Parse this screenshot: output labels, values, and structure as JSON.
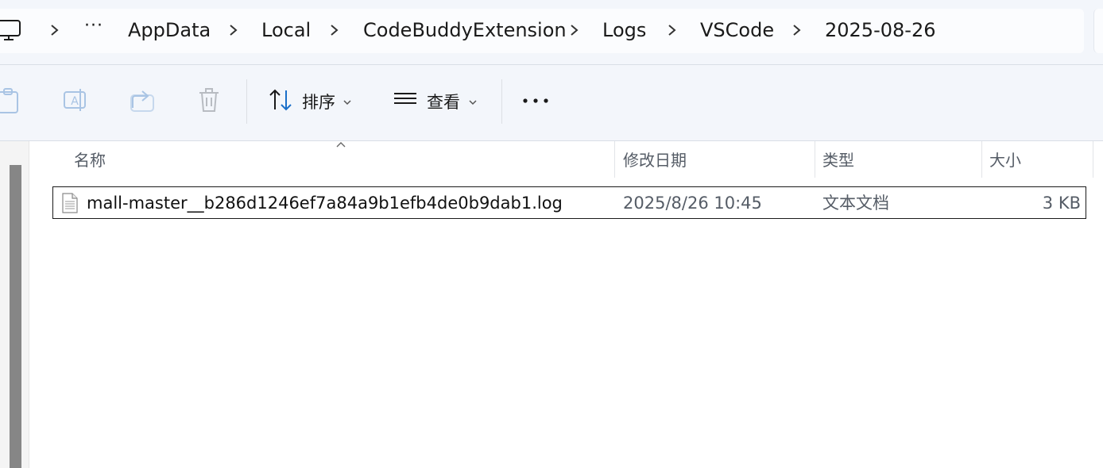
{
  "breadcrumb": {
    "items": [
      {
        "label": "···"
      },
      {
        "label": "AppData"
      },
      {
        "label": "Local"
      },
      {
        "label": "CodeBuddyExtension"
      },
      {
        "label": "Logs"
      },
      {
        "label": "VSCode"
      },
      {
        "label": "2025-08-26"
      }
    ]
  },
  "toolbar": {
    "sort_label": "排序",
    "view_label": "查看",
    "icons": [
      "paste-icon",
      "rename-icon",
      "share-icon",
      "delete-icon",
      "sort-icon",
      "view-icon",
      "more-icon"
    ]
  },
  "columns": {
    "name": "名称",
    "modified": "修改日期",
    "type": "类型",
    "size": "大小"
  },
  "files": [
    {
      "name": "mall-master__b286d1246ef7a84a9b1efb4de0b9dab1.log",
      "modified": "2025/8/26 10:45",
      "type": "文本文档",
      "size": "3 KB"
    }
  ],
  "colors": {
    "chrome_bg": "#f3f6fb",
    "accent": "#1a6fc9",
    "scroll_thumb": "#868686"
  }
}
